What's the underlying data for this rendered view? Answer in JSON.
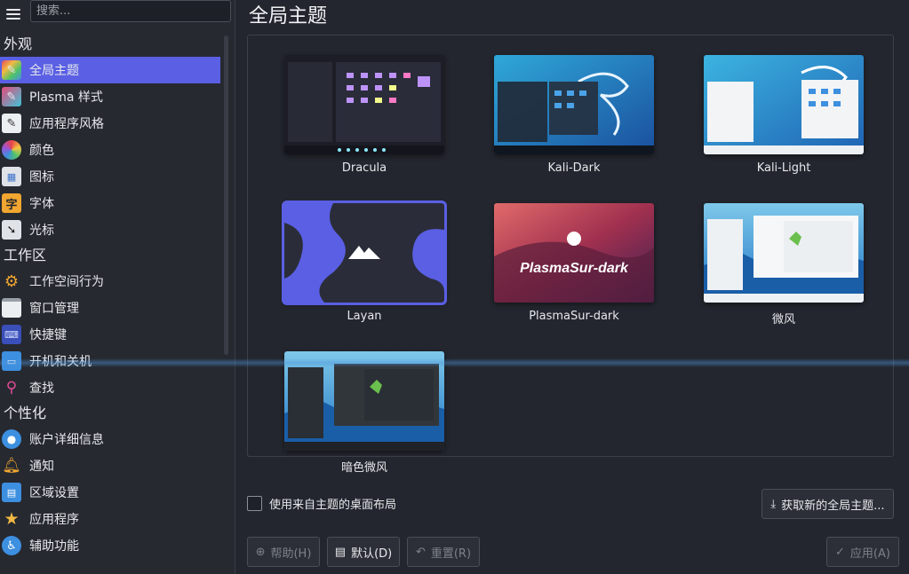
{
  "search": {
    "placeholder": "搜索..."
  },
  "sidebar": {
    "sections": [
      {
        "title": "外观",
        "items": [
          {
            "label": "全局主题",
            "icon": "global-theme-icon",
            "active": true
          },
          {
            "label": "Plasma 样式",
            "icon": "plasma-style-icon"
          },
          {
            "label": "应用程序风格",
            "icon": "app-style-icon"
          },
          {
            "label": "颜色",
            "icon": "color-icon"
          },
          {
            "label": "图标",
            "icon": "icons-icon"
          },
          {
            "label": "字体",
            "icon": "font-icon"
          },
          {
            "label": "光标",
            "icon": "cursor-icon"
          }
        ]
      },
      {
        "title": "工作区",
        "items": [
          {
            "label": "工作空间行为",
            "icon": "workspace-behavior-icon"
          },
          {
            "label": "窗口管理",
            "icon": "window-management-icon"
          },
          {
            "label": "快捷键",
            "icon": "shortcuts-icon"
          },
          {
            "label": "开机和关机",
            "icon": "startup-shutdown-icon"
          },
          {
            "label": "查找",
            "icon": "search-icon"
          }
        ]
      },
      {
        "title": "个性化",
        "items": [
          {
            "label": "账户详细信息",
            "icon": "account-icon"
          },
          {
            "label": "通知",
            "icon": "bell-icon"
          },
          {
            "label": "区域设置",
            "icon": "region-icon"
          },
          {
            "label": "应用程序",
            "icon": "star-icon"
          },
          {
            "label": "辅助功能",
            "icon": "accessibility-icon"
          }
        ]
      }
    ]
  },
  "main": {
    "title": "全局主题",
    "themes": [
      {
        "name": "Dracula"
      },
      {
        "name": "Kali-Dark"
      },
      {
        "name": "Kali-Light"
      },
      {
        "name": "Layan",
        "selected": true
      },
      {
        "name": "PlasmaSur-dark",
        "thumb_text": "PlasmaSur-dark"
      },
      {
        "name": "微风"
      },
      {
        "name": "暗色微风"
      }
    ],
    "use_desktop_layout_label": "使用来自主题的桌面布局",
    "get_new_label": "获取新的全局主题...",
    "help_label": "帮助(H)",
    "default_label": "默认(D)",
    "reset_label": "重置(R)",
    "apply_label": "应用(A)"
  },
  "colors": {
    "accent": "#5a5fe4",
    "background": "#23262e"
  }
}
